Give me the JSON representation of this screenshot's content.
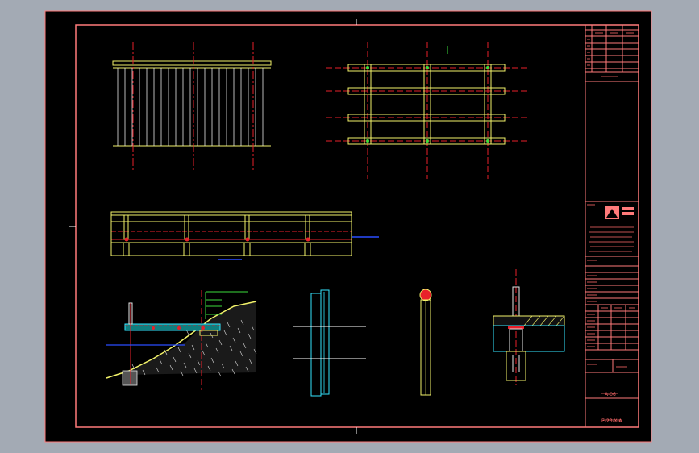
{
  "colors": {
    "background": "#a3aab4",
    "sheet": "#000000",
    "frame": "#ff7a7a",
    "yellow": "#f2f26a",
    "red": "#e8202a",
    "cyan": "#33e6ff",
    "white": "#ffffff",
    "blue": "#2a4dff",
    "green": "#3ddc3d"
  },
  "title_block": {
    "logo": "logo-mark",
    "sheet_no": "A-06",
    "footer": "E-23-X-A"
  },
  "icons": {
    "logo": "company-logo-icon",
    "mark": "section-mark-icon"
  }
}
